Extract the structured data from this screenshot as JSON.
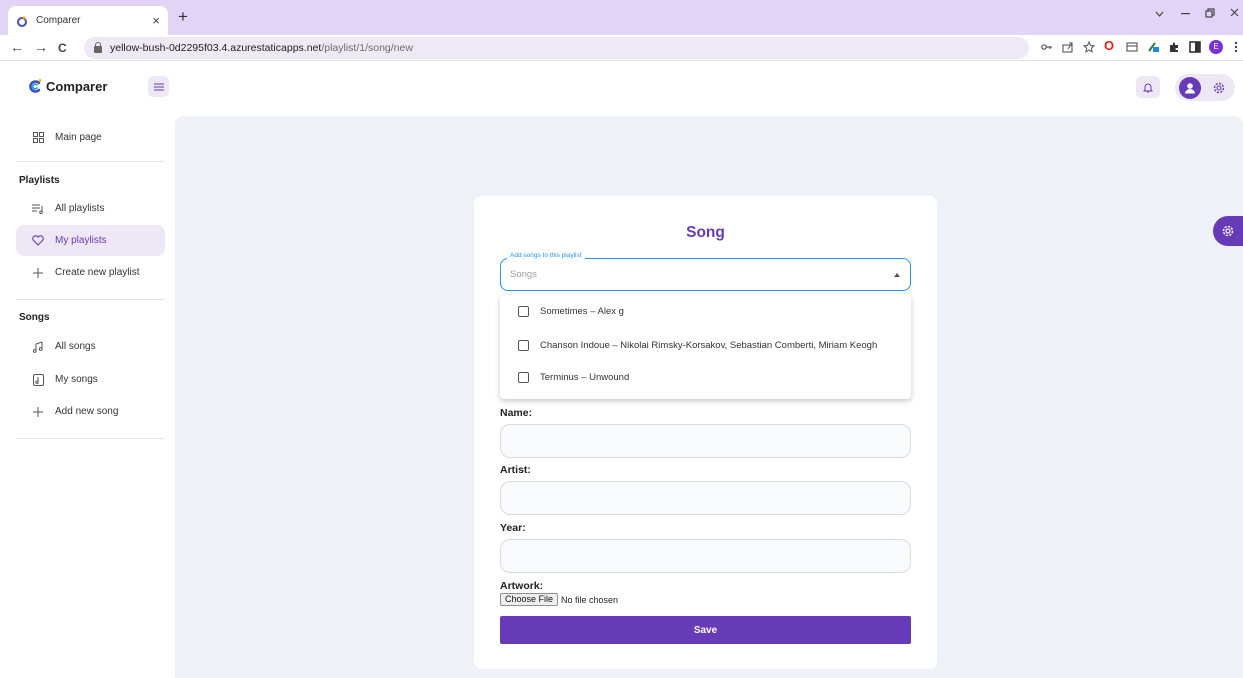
{
  "browser": {
    "tab_title": "Comparer",
    "tab_close": "×",
    "new_tab": "+",
    "url_host": "yellow-bush-0d2295f03.4.azurestaticapps.net",
    "url_path": "/playlist/1/song/new",
    "back": "←",
    "forward": "→",
    "reload": "C",
    "profile_initial": "E"
  },
  "app": {
    "name": "Comparer"
  },
  "sidebar": {
    "main_page": "Main page",
    "playlists_caption": "Playlists",
    "playlists_items": [
      {
        "label": "All playlists",
        "icon": "list-music-icon"
      },
      {
        "label": "My playlists",
        "icon": "heart-icon",
        "active": true
      },
      {
        "label": "Create new playlist",
        "icon": "plus-icon"
      }
    ],
    "songs_caption": "Songs",
    "songs_items": [
      {
        "label": "All songs",
        "icon": "music-notes-icon"
      },
      {
        "label": "My songs",
        "icon": "music-file-icon"
      },
      {
        "label": "Add new song",
        "icon": "plus-icon"
      }
    ]
  },
  "form": {
    "title": "Song",
    "select_legend": "Add songs to this playlist",
    "select_placeholder": "Songs",
    "options": [
      {
        "label": "Sometimes – Alex g",
        "checked": false
      },
      {
        "label": "Chanson Indoue – Nikolai Rimsky-Korsakov, Sebastian Comberti, Miriam Keogh",
        "checked": false
      },
      {
        "label": "Terminus – Unwound",
        "checked": false
      }
    ],
    "name_label": "Name:",
    "artist_label": "Artist:",
    "year_label": "Year:",
    "artwork_label": "Artwork:",
    "choose_file": "Choose File",
    "no_file": "No file chosen",
    "save": "Save"
  },
  "colors": {
    "accent": "#673ab7",
    "focus": "#2196f3",
    "main_bg": "#eef2f6",
    "tabbar": "#e2d4f7"
  }
}
